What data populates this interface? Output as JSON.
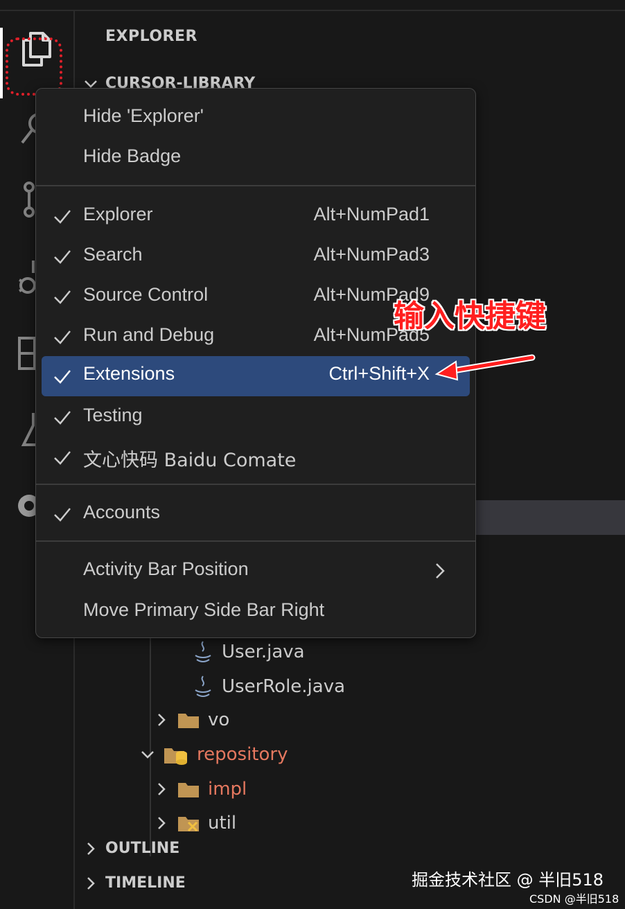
{
  "sidebar": {
    "title": "EXPLORER",
    "project_header": "CURSOR-LIBRARY",
    "outline": "OUTLINE",
    "timeline": "TIMELINE",
    "tree": [
      {
        "label": "User.java",
        "icon": "java-icon",
        "highlight": false
      },
      {
        "label": "UserRole.java",
        "icon": "java-icon",
        "highlight": false
      },
      {
        "label": "vo",
        "icon": "folder-icon",
        "highlight": false
      },
      {
        "label": "repository",
        "icon": "repository-folder-icon",
        "highlight": true
      },
      {
        "label": "impl",
        "icon": "folder-icon",
        "highlight": true
      },
      {
        "label": "util",
        "icon": "util-folder-icon",
        "highlight": false
      }
    ]
  },
  "menu": {
    "hide_explorer": "Hide 'Explorer'",
    "hide_badge": "Hide Badge",
    "items": [
      {
        "label": "Explorer",
        "shortcut": "Alt+NumPad1",
        "checked": true
      },
      {
        "label": "Search",
        "shortcut": "Alt+NumPad3",
        "checked": true
      },
      {
        "label": "Source Control",
        "shortcut": "Alt+NumPad9",
        "checked": true
      },
      {
        "label": "Run and Debug",
        "shortcut": "Alt+NumPad5",
        "checked": true
      },
      {
        "label": "Extensions",
        "shortcut": "Ctrl+Shift+X",
        "checked": true,
        "active": true
      },
      {
        "label": "Testing",
        "shortcut": "",
        "checked": true
      },
      {
        "label": "文心快码 Baidu Comate",
        "shortcut": "",
        "checked": true
      }
    ],
    "accounts": "Accounts",
    "activity_bar_position": "Activity Bar Position",
    "move_primary_side_bar": "Move Primary Side Bar Right"
  },
  "annotation": {
    "text": "输入快捷键",
    "color": "#ff1f1f"
  },
  "watermark": {
    "main": "掘金技术社区 @ 半旧518",
    "csdn": "CSDN @半旧518"
  },
  "colors": {
    "background": "#181818",
    "menu_background": "#1f1f1f",
    "active_item": "#2d4a7c",
    "red_text": "#e5785f",
    "highlight_border": "#e0202a"
  }
}
